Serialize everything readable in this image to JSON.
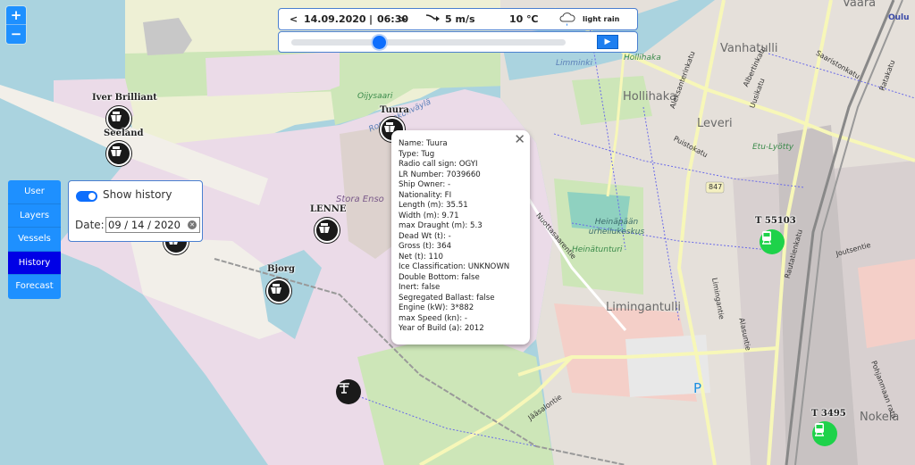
{
  "map": {
    "zoom_in_label": "+",
    "zoom_out_label": "−",
    "districts": [
      "Vanhatulli",
      "Hollihaka",
      "Leveri",
      "Limingantulli",
      "Nokela",
      "Vaara"
    ],
    "green_labels": [
      "Hollihaka",
      "Heinätunturi",
      "Oijysaari",
      "Etu-Lyötty"
    ],
    "park_label": "Heinäpään urheilukeskus",
    "water_labels": [
      "Limminki",
      "Rommakonväylä"
    ],
    "industrial_label": "Stora Enso",
    "roads": [
      "Albertinkatu",
      "Aleksanterinkatu",
      "Uusikatu",
      "Puistokatu",
      "Saaristonkatu",
      "Ratakatu",
      "Rautatienkatu",
      "Nuottasaarentie",
      "Limingantie",
      "Alasuntie",
      "Jääsalontie",
      "Joutsentie",
      "Pohjanmaan rata"
    ],
    "road_shield": "847",
    "city_label": "Oulu",
    "parking_symbol": "P"
  },
  "time_panel": {
    "prev": "<",
    "date": "14.09.2020",
    "separator": "|",
    "time": "06:30",
    "next": ">",
    "wind": "5 m/s",
    "temperature": "10 ℃",
    "weather": "light rain",
    "wind_icon": "wind-arrow-icon",
    "weather_icon": "rain-cloud-icon"
  },
  "slider": {
    "progress": 0.32,
    "play_label": "▶"
  },
  "side_menu": {
    "items": [
      {
        "label": "User",
        "active": false
      },
      {
        "label": "Layers",
        "active": false
      },
      {
        "label": "Vessels",
        "active": false
      },
      {
        "label": "History",
        "active": true
      },
      {
        "label": "Forecast",
        "active": false
      }
    ]
  },
  "history_panel": {
    "toggle_on": true,
    "toggle_label": "Show history",
    "date_label": "Date:",
    "date_value": "09 / 14 / 2020"
  },
  "vessels": [
    {
      "name": "Iver Brilliant"
    },
    {
      "name": "Seeland"
    },
    {
      "name": "Tuura"
    },
    {
      "name": "LENNE"
    },
    {
      "name": "Bjorg"
    }
  ],
  "trains": [
    {
      "name": "T 55103"
    },
    {
      "name": "T 3495"
    }
  ],
  "popup": {
    "close_label": "✕",
    "rows": [
      "Name: Tuura",
      "Type: Tug",
      "Radio call sign: OGYI",
      "LR Number: 7039660",
      "Ship Owner: -",
      "Nationality: FI",
      "Length (m): 35.51",
      "Width (m): 9.71",
      "max Draught (m): 5.3",
      "Dead Wt (t): -",
      "Gross (t): 364",
      "Net (t): 110",
      "Ice Classification: UNKNOWN",
      "Double Bottom: false",
      "Inert: false",
      "Segregated Ballast: false",
      "Engine (kW): 3*882",
      "max Speed (kn): -",
      "Year of Build (a): 2012"
    ]
  },
  "colors": {
    "accent": "#1e90ff",
    "active_menu": "#0000e6",
    "water": "#aad3df",
    "industrial": "#ebdbe8",
    "train_marker": "#1ed24a"
  }
}
